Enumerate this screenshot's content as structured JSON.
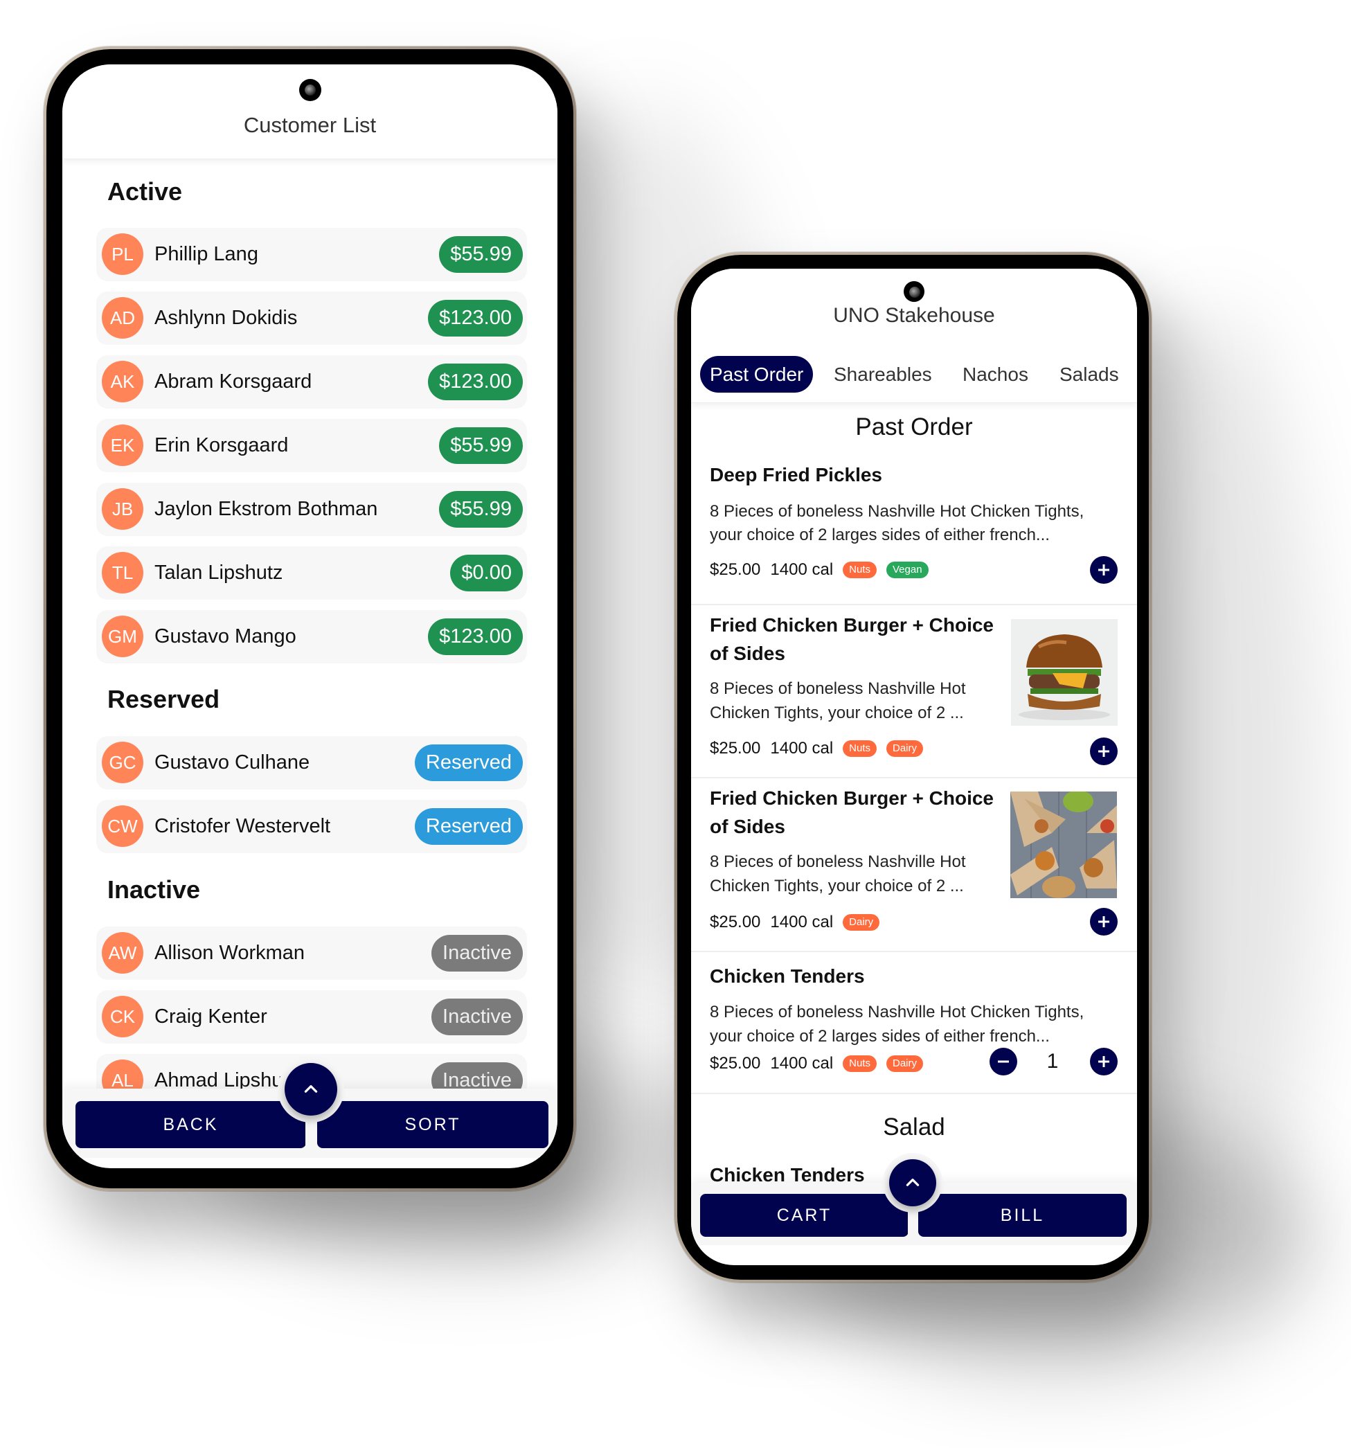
{
  "customer_list_screen": {
    "title": "Customer List",
    "sections": [
      {
        "title": "Active",
        "customers": [
          {
            "initials": "PL",
            "name": "Phillip Lang",
            "badge": "$55.99",
            "badge_type": "active"
          },
          {
            "initials": "AD",
            "name": "Ashlynn Dokidis",
            "badge": "$123.00",
            "badge_type": "active"
          },
          {
            "initials": "AK",
            "name": "Abram Korsgaard",
            "badge": "$123.00",
            "badge_type": "active"
          },
          {
            "initials": "EK",
            "name": "Erin Korsgaard",
            "badge": "$55.99",
            "badge_type": "active"
          },
          {
            "initials": "JB",
            "name": "Jaylon Ekstrom Bothman",
            "badge": "$55.99",
            "badge_type": "active"
          },
          {
            "initials": "TL",
            "name": "Talan Lipshutz",
            "badge": "$0.00",
            "badge_type": "active"
          },
          {
            "initials": "GM",
            "name": "Gustavo Mango",
            "badge": "$123.00",
            "badge_type": "active"
          }
        ]
      },
      {
        "title": "Reserved",
        "customers": [
          {
            "initials": "GC",
            "name": "Gustavo Culhane",
            "badge": "Reserved",
            "badge_type": "reserved"
          },
          {
            "initials": "CW",
            "name": "Cristofer Westervelt",
            "badge": "Reserved",
            "badge_type": "reserved"
          }
        ]
      },
      {
        "title": "Inactive",
        "customers": [
          {
            "initials": "AW",
            "name": "Allison Workman",
            "badge": "Inactive",
            "badge_type": "inactive"
          },
          {
            "initials": "CK",
            "name": "Craig Kenter",
            "badge": "Inactive",
            "badge_type": "inactive"
          },
          {
            "initials": "AL",
            "name": "Ahmad Lipshutz",
            "badge": "Inactive",
            "badge_type": "inactive"
          }
        ]
      }
    ],
    "footer": {
      "back_label": "BACK",
      "sort_label": "SORT",
      "fab_icon": "chevron-up-icon"
    }
  },
  "menu_screen": {
    "title": "UNO Stakehouse",
    "tabs": [
      {
        "label": "Past Order",
        "active": true
      },
      {
        "label": "Shareables",
        "active": false
      },
      {
        "label": "Nachos",
        "active": false
      },
      {
        "label": "Salads",
        "active": false
      }
    ],
    "sections": [
      {
        "heading": "Past Order",
        "items": [
          {
            "title": "Deep Fried Pickles",
            "description_lines": [
              "8 Pieces of boneless Nashville Hot Chicken Tights,",
              "your choice of 2 larges sides of either french..."
            ],
            "price": "$25.00",
            "calories": "1400 cal",
            "tags": [
              {
                "label": "Nuts",
                "type": "nuts"
              },
              {
                "label": "Vegan",
                "type": "vegan"
              }
            ],
            "image": null,
            "quantity": null
          },
          {
            "title_lines": [
              "Fried Chicken Burger + Choice",
              "of Sides"
            ],
            "description_lines": [
              "8 Pieces of boneless Nashville Hot",
              "Chicken Tights, your choice of 2 ..."
            ],
            "price": "$25.00",
            "calories": "1400 cal",
            "tags": [
              {
                "label": "Nuts",
                "type": "nuts"
              },
              {
                "label": "Dairy",
                "type": "dairy"
              }
            ],
            "image": "burger-photo",
            "quantity": null
          },
          {
            "title_lines": [
              "Fried Chicken Burger + Choice",
              "of Sides"
            ],
            "description_lines": [
              "8 Pieces of boneless Nashville Hot",
              "Chicken Tights, your choice of 2 ..."
            ],
            "price": "$25.00",
            "calories": "1400 cal",
            "tags": [
              {
                "label": "Dairy",
                "type": "dairy"
              }
            ],
            "image": "wraps-photo",
            "quantity": null
          },
          {
            "title": "Chicken Tenders",
            "description_lines": [
              "8 Pieces of boneless Nashville Hot Chicken Tights,",
              "your choice of 2 larges sides of either french..."
            ],
            "price": "$25.00",
            "calories": "1400 cal",
            "tags": [
              {
                "label": "Nuts",
                "type": "nuts"
              },
              {
                "label": "Dairy",
                "type": "dairy"
              }
            ],
            "image": null,
            "quantity": "1"
          }
        ]
      },
      {
        "heading": "Salad",
        "items": [
          {
            "title": "Chicken Tenders"
          }
        ]
      }
    ],
    "footer": {
      "cart_label": "CART",
      "bill_label": "BILL",
      "fab_icon": "chevron-up-icon"
    }
  },
  "colors": {
    "primary_navy": "#02034f",
    "avatar_orange": "#ff8559",
    "active_green": "#1f9150",
    "reserved_blue": "#2b9bdb",
    "inactive_gray": "#7b7b7b",
    "tag_orange": "#ff6a3d",
    "tag_green": "#27a85a"
  }
}
